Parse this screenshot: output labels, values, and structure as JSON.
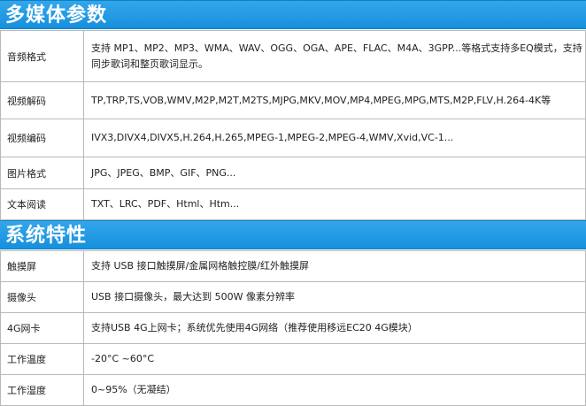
{
  "multimedia": {
    "title": "多媒体参数",
    "rows": [
      {
        "label": "音频格式",
        "value": "支持 MP1、MP2、MP3、WMA、WAV、OGG、OGA、APE、FLAC、M4A、3GPP...等格式支持多EQ模式，支持同步歌词和整页歌词显示。"
      },
      {
        "label": "视频解码",
        "value": "TP,TRP,TS,VOB,WMV,M2P,M2T,M2TS,MJPG,MKV,MOV,MP4,MPEG,MPG,MTS,M2P,FLV,H.264-4K等"
      },
      {
        "label": "视频编码",
        "value": "IVX3,DIVX4,DIVX5,H.264,H.265,MPEG-1,MPEG-2,MPEG-4,WMV,Xvid,VC-1..."
      },
      {
        "label": "图片格式",
        "value": "JPG、JPEG、BMP、GIF、PNG..."
      },
      {
        "label": "文本阅读",
        "value": "TXT、LRC、PDF、Html、Htm..."
      }
    ]
  },
  "system": {
    "title": "系统特性",
    "rows": [
      {
        "label": "触摸屏",
        "value": "支持 USB 接口触摸屏/金属网格触控膜/红外触摸屏"
      },
      {
        "label": "摄像头",
        "value": "USB 接口摄像头，最大达到 500W 像素分辨率"
      },
      {
        "label": "4G网卡",
        "value": "支持USB 4G上网卡；系统优先使用4G网络（推荐使用移远EC20 4G模块）"
      },
      {
        "label": "工作温度",
        "value": "-20°C ~60°C"
      },
      {
        "label": "工作湿度",
        "value": "0~95%（无凝结）"
      }
    ]
  }
}
